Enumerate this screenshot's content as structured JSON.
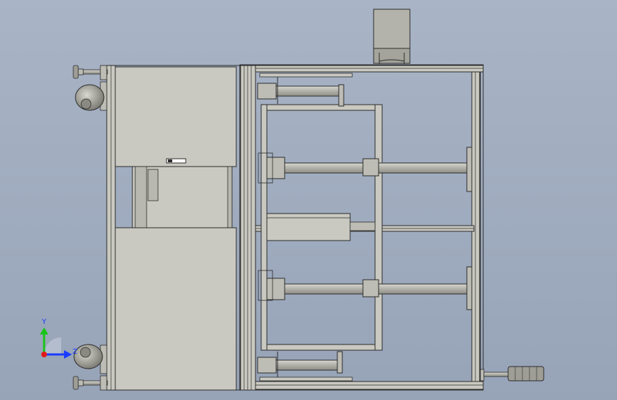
{
  "view": {
    "background_color": "#a3aec1",
    "part_fill": "#c9c9c1",
    "part_fill_dark": "#a8a8a0",
    "edge_color": "#2b2b2b",
    "shaft_color": "#b5b5ad"
  },
  "triad": {
    "x_label": "",
    "y_label": "Y",
    "z_label": "Z",
    "x_color": "#1a3cff",
    "y_color": "#19c419",
    "z_color": "#e01b1b"
  }
}
